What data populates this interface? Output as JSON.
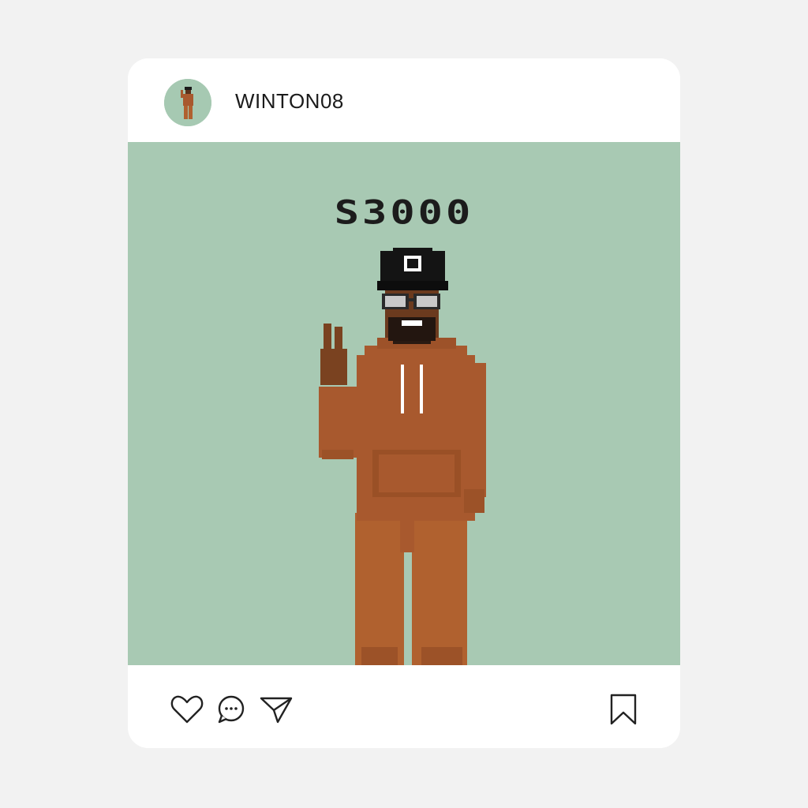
{
  "post": {
    "username": "WINTON08",
    "image_text": "S3000",
    "avatar_icon": "pixel-character-avatar",
    "colors": {
      "image_background": "#a8c9b3",
      "hoodie": "#a8592e",
      "card": "#ffffff",
      "page": "#f2f2f2"
    }
  },
  "actions": {
    "like_icon": "heart-icon",
    "comment_icon": "speech-bubble-icon",
    "share_icon": "paper-plane-icon",
    "save_icon": "bookmark-icon"
  }
}
